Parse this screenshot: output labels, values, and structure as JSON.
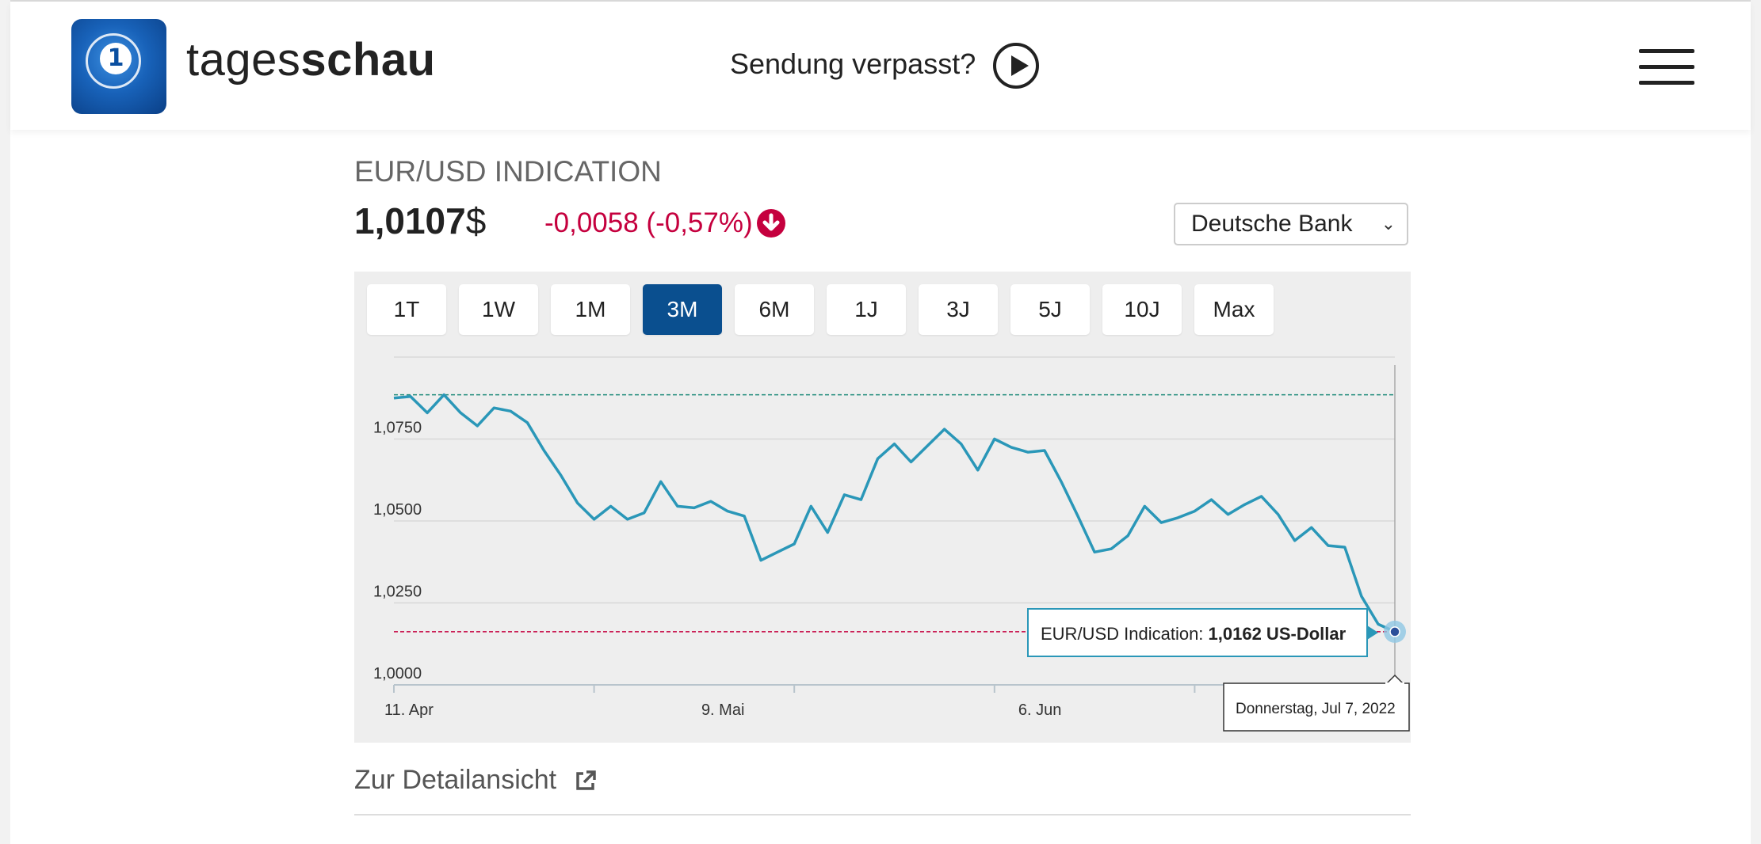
{
  "header": {
    "brand_light": "tages",
    "brand_bold": "schau",
    "missed_label": "Sendung verpasst?"
  },
  "instrument": {
    "title": "EUR/USD INDICATION",
    "price": "1,0107",
    "currency_symbol": "$",
    "change": "-0,0058 (-0,57%)",
    "source_selected": "Deutsche Bank"
  },
  "ranges": [
    "1T",
    "1W",
    "1M",
    "3M",
    "6M",
    "1J",
    "3J",
    "5J",
    "10J",
    "Max"
  ],
  "active_range": "3M",
  "tooltip": {
    "label": "EUR/USD Indication: ",
    "value": "1,0162 US-Dollar",
    "date": "Donnerstag, Jul 7, 2022"
  },
  "detail_link": "Zur Detailansicht",
  "colors": {
    "accent_blue": "#0a4f8f",
    "negative": "#c5003e",
    "line": "#2a97b8",
    "high_line": "#1f8a7a"
  },
  "chart_data": {
    "type": "line",
    "x_tick_labels": [
      "11. Apr",
      "9. Mai",
      "6. Jun"
    ],
    "y_tick_labels": [
      "1,0000",
      "1,0250",
      "1,0500",
      "1,0750"
    ],
    "ylim": [
      1.0,
      1.1
    ],
    "high_reference": 1.0885,
    "low_reference": 1.0162,
    "series": [
      {
        "values": [
          1.0875,
          1.088,
          1.083,
          1.0885,
          1.083,
          1.079,
          1.0845,
          1.0835,
          1.08,
          1.0715,
          1.064,
          1.0555,
          1.0505,
          1.0545,
          1.0505,
          1.0525,
          1.062,
          1.0545,
          1.054,
          1.056,
          1.053,
          1.0515,
          1.038,
          1.0405,
          1.043,
          1.0545,
          1.0465,
          1.058,
          1.0565,
          1.069,
          1.0735,
          1.068,
          1.073,
          1.078,
          1.0735,
          1.0655,
          1.075,
          1.0725,
          1.071,
          1.0715,
          1.062,
          1.0515,
          1.0405,
          1.0415,
          1.0455,
          1.0545,
          1.0495,
          1.051,
          1.053,
          1.0565,
          1.052,
          1.055,
          1.0575,
          1.052,
          1.044,
          1.048,
          1.0425,
          1.042,
          1.027,
          1.0185,
          1.0162
        ]
      }
    ]
  }
}
